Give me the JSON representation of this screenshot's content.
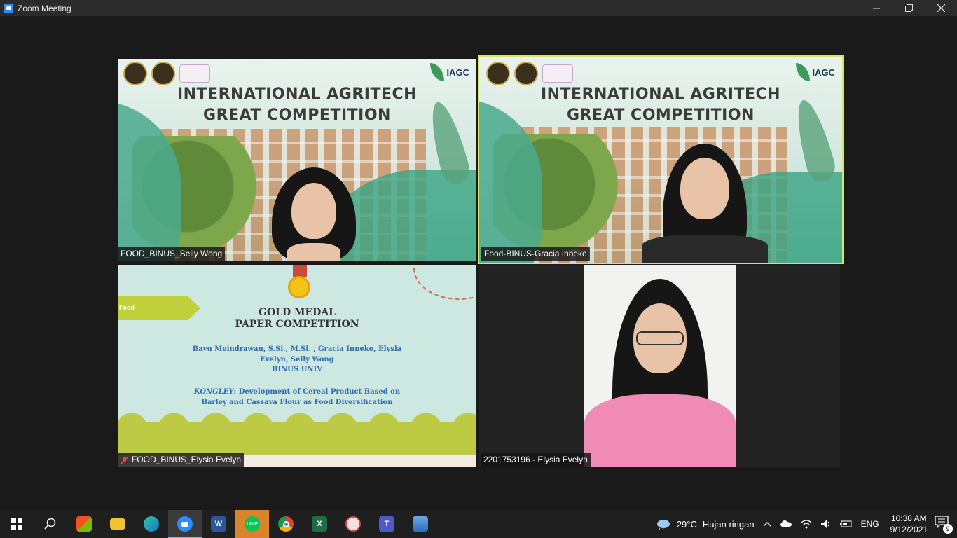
{
  "window": {
    "title": "Zoom Meeting"
  },
  "banner": {
    "title_line1": "INTERNATIONAL AGRITECH",
    "title_line2": "GREAT COMPETITION",
    "logo_text": "IAGC"
  },
  "tiles": [
    {
      "name": "FOOD_BINUS_Selly Wong",
      "speaking": false
    },
    {
      "name": "Food-BINUS-Gracia Inneke",
      "speaking": true
    },
    {
      "name": "FOOD_BINUS_Elysia Evelyn",
      "muted": true
    },
    {
      "name": "2201753196 - Elysia Evelyn"
    }
  ],
  "slide": {
    "tag": "Food",
    "heading1": "GOLD MEDAL",
    "heading2": "PAPER COMPETITION",
    "authors": "Bayu Meindrawan, S.Si., M.Si. , Gracia Inneke, Elysia Evelyn, Selly Wong",
    "university": "BINUS UNIV",
    "paper_title_em": "KONGLEY",
    "paper_title_rest": ": Development of Cereal Product Based on Barley and Cassava Flour as Food Diversification"
  },
  "taskbar": {
    "apps": [
      "start-icon",
      "search-icon",
      "store-icon",
      "file-explorer-icon",
      "edge-icon",
      "zoom-icon",
      "word-icon",
      "line-icon",
      "chrome-icon",
      "excel-icon",
      "paint-icon",
      "teams-icon",
      "photos-icon"
    ],
    "line_label": "LINE",
    "weather_temp": "29°C",
    "weather_desc": "Hujan ringan",
    "language": "ENG",
    "time": "10:38 AM",
    "date": "9/12/2021",
    "notification_count": "9"
  },
  "colors": {
    "speaking_border": "#d4e56a",
    "zoom_blue": "#2d8cff",
    "slide_bg": "#cde7e1",
    "slide_text": "#2f6db0"
  }
}
